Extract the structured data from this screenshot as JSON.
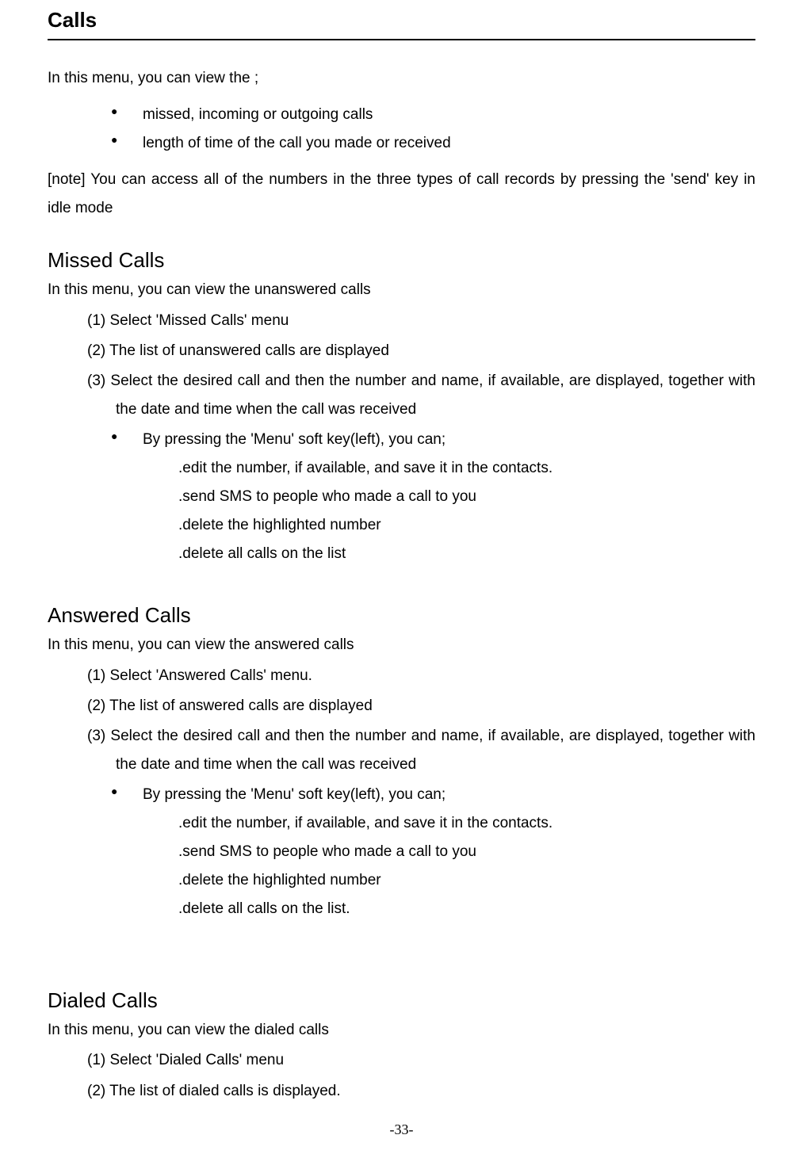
{
  "title": "Calls",
  "intro": "In this menu, you can view the ;",
  "bullets": [
    "missed, incoming or outgoing calls",
    "length of time of the call you made or received"
  ],
  "note": "[note] You can access all of the numbers in the three types of call records by pressing the 'send' key in idle mode",
  "sections": {
    "missed": {
      "title": "Missed Calls",
      "intro": "In this menu, you can view the unanswered calls",
      "step1": "(1) Select 'Missed Calls' menu",
      "step2": "(2) The list of unanswered calls are displayed",
      "step3": "(3) Select the desired call and then the number and name, if available, are displayed, together with the date and time when the call was received",
      "menuIntro": "By pressing the 'Menu' soft key(left), you can;",
      "actions": [
        ".edit the number, if available, and save it in the contacts.",
        ".send SMS to people who made a call to you",
        ".delete the highlighted number",
        ".delete all calls on the list"
      ]
    },
    "answered": {
      "title": "Answered Calls",
      "intro": "In this menu, you can view the answered calls",
      "step1": "(1) Select 'Answered Calls' menu.",
      "step2": "(2) The list of answered calls are displayed",
      "step3": "(3) Select the desired call and then the number and name, if available, are displayed, together with the date and time when the call was received",
      "menuIntro": "By pressing the 'Menu' soft key(left), you can;",
      "actions": [
        ".edit the number, if available, and save it in the contacts.",
        ".send SMS to people who made a call to you",
        ".delete the highlighted number",
        ".delete all calls on the list."
      ]
    },
    "dialed": {
      "title": "Dialed Calls",
      "intro": "In this menu, you can view the dialed calls",
      "step1": "(1) Select 'Dialed Calls' menu",
      "step2": "(2) The list of dialed calls is displayed."
    }
  },
  "pageNumber": "-33-"
}
